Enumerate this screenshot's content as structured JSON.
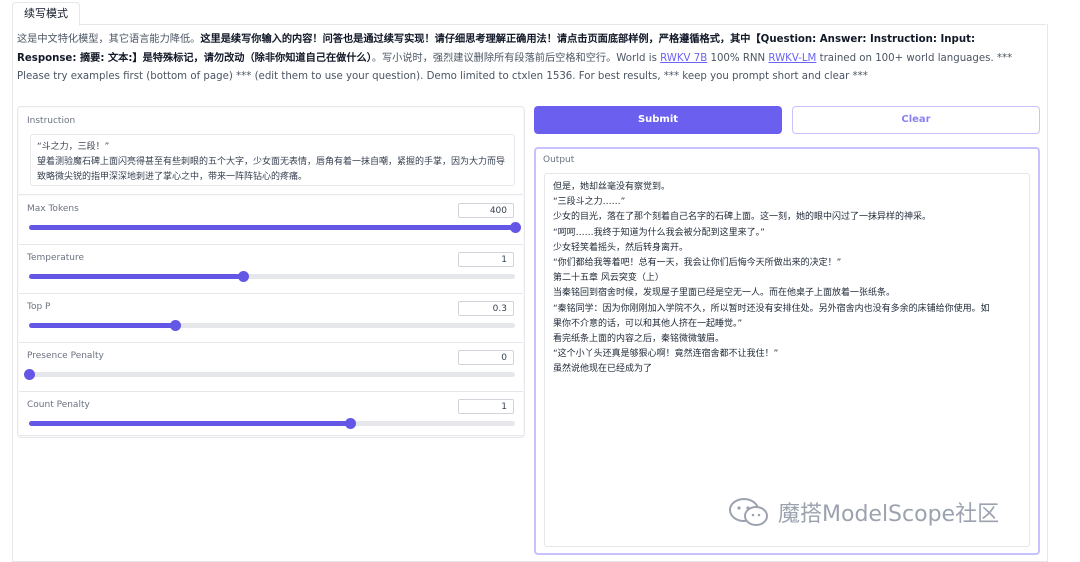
{
  "tab": {
    "label": "续写模式"
  },
  "description": {
    "s1": "这是中文特化模型，其它语言能力降低。",
    "s2": "这里是续写你输入的内容！问答也是通过续写实现！请仔细思考理解正确用法！请点击页面底部样例，严格遵循格式，其中【Question: Answer: Instruction: Input: Response: 摘要: 文本:】是特殊标记，请勿改动（除非你知道自己在做什么）",
    "s3": "。写小说时，强烈建议删除所有段落前后空格和空行。World is ",
    "link1": "RWKV 7B",
    "s4": " 100% RNN ",
    "link2": "RWKV-LM",
    "s5": " trained on 100+ world languages. *** Please try examples first (bottom of page) *** (edit them to use your question). Demo limited to ctxlen 1536. For best results, *** keep you prompt short and clear ***"
  },
  "instruction": {
    "label": "Instruction",
    "value": "“斗之力，三段！”\n望着测验魔石碑上面闪亮得甚至有些刺眼的五个大字，少女面无表情，唇角有着一抹自嘲，紧握的手掌，因为大力而导致略微尖锐的指甲深深地刺进了掌心之中，带来一阵阵钻心的疼痛。"
  },
  "sliders": [
    {
      "label": "Max Tokens",
      "value": "400",
      "fraction": 1.0
    },
    {
      "label": "Temperature",
      "value": "1",
      "fraction": 0.44
    },
    {
      "label": "Top P",
      "value": "0.3",
      "fraction": 0.3
    },
    {
      "label": "Presence Penalty",
      "value": "0",
      "fraction": 0.0
    },
    {
      "label": "Count Penalty",
      "value": "1",
      "fraction": 0.66
    }
  ],
  "buttons": {
    "submit": "Submit",
    "clear": "Clear"
  },
  "output": {
    "label": "Output",
    "lines": [
      "但是，她却丝毫没有察觉到。",
      "“三段斗之力……”",
      "少女的目光，落在了那个刻着自己名字的石碑上面。这一刻，她的眼中闪过了一抹异样的神采。",
      "“呵呵……我终于知道为什么我会被分配到这里来了。”",
      "少女轻笑着摇头，然后转身离开。",
      "“你们都给我等着吧！总有一天，我会让你们后悔今天所做出来的决定！”",
      "第二十五章 风云突变（上）",
      "当秦铭回到宿舍时候，发现屋子里面已经是空无一人。而在他桌子上面放着一张纸条。",
      "“秦铭同学：因为你刚刚加入学院不久，所以暂时还没有安排住处。另外宿舍内也没有多余的床铺给你使用。如",
      "果你不介意的话，可以和其他人挤在一起睡觉。”",
      "看完纸条上面的内容之后，秦铭微微皱眉。",
      "“这个小丫头还真是够狠心啊！竟然连宿舍都不让我住！”",
      "虽然说他现在已经成为了"
    ]
  },
  "watermark": {
    "text": "魔搭ModelScope社区",
    "icon": "wechat-icon"
  },
  "colors": {
    "accent": "#6457e5",
    "submit_bg": "#6b5ff0",
    "clear_border": "#c7c2fb"
  }
}
